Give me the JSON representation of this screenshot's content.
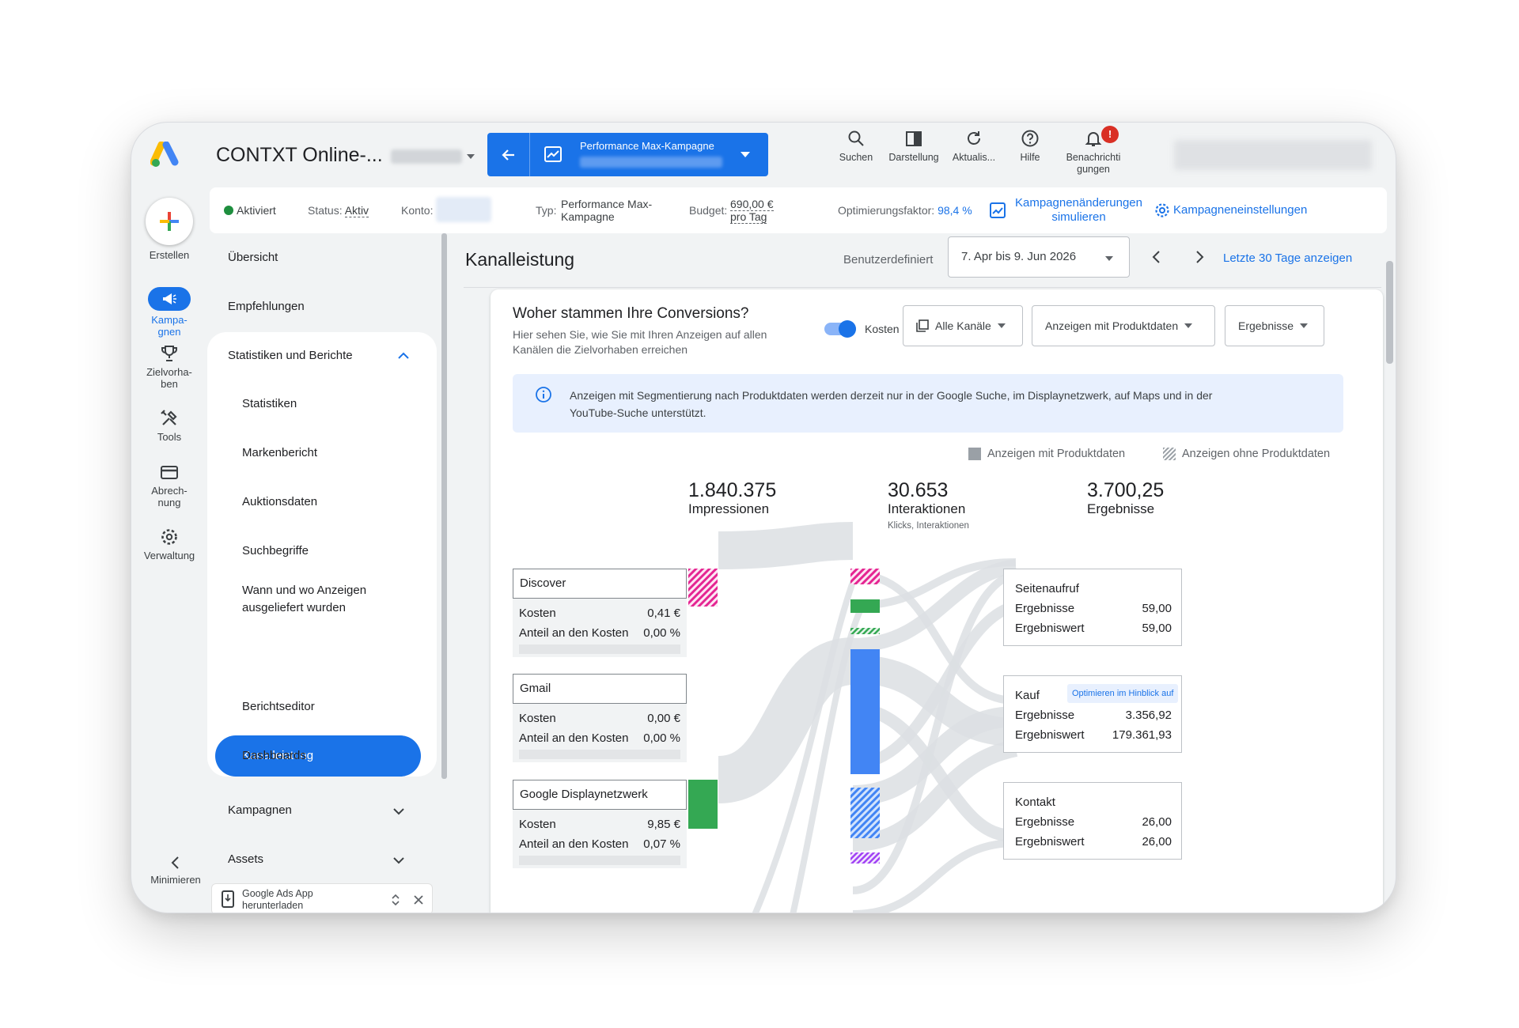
{
  "app": {
    "account_title": "CONTXT Online-...",
    "campaign_type": "Performance Max-Kampagne"
  },
  "toolbar": {
    "search": "Suchen",
    "appearance": "Darstellung",
    "refresh": "Aktualis...",
    "help": "Hilfe",
    "notifications_line1": "Benachrichti",
    "notifications_line2": "gungen",
    "notification_badge": "!"
  },
  "status": {
    "activated": "Aktiviert",
    "status_label": "Status:",
    "status_value": "Aktiv",
    "account_label": "Konto:",
    "type_label": "Typ:",
    "type_value_line1": "Performance Max-",
    "type_value_line2": "Kampagne",
    "budget_label": "Budget:",
    "budget_value_line1": "690,00 €",
    "budget_value_line2": "pro Tag",
    "opt_label": "Optimierungsfaktor:",
    "opt_value": "98,4 %",
    "simulate_line1": "Kampagnenänderungen",
    "simulate_line2": "simulieren",
    "settings": "Kampagneneinstellungen"
  },
  "rail": {
    "create": "Erstellen",
    "campaigns_line1": "Kampa-",
    "campaigns_line2": "gnen",
    "goals_line1": "Zielvorha-",
    "goals_line2": "ben",
    "tools": "Tools",
    "billing_line1": "Abrech-",
    "billing_line2": "nung",
    "admin": "Verwaltung",
    "minimize": "Minimieren"
  },
  "nav": {
    "overview": "Übersicht",
    "recommendations": "Empfehlungen",
    "insights_reports": "Statistiken und Berichte",
    "sub": {
      "statistics": "Statistiken",
      "brand_report": "Markenbericht",
      "auction": "Auktionsdaten",
      "search_terms": "Suchbegriffe",
      "where_when_line1": "Wann und wo Anzeigen",
      "where_when_line2": "ausgeliefert wurden",
      "channel_performance": "Kanalleistung",
      "report_editor": "Berichtseditor",
      "dashboards": "Dashboards"
    },
    "campaigns": "Kampagnen",
    "assets": "Assets",
    "app_download_line1": "Google Ads App",
    "app_download_line2": "herunterladen"
  },
  "main": {
    "title": "Kanalleistung",
    "date_label": "Benutzerdefiniert",
    "date_range": "7. Apr bis 9. Jun 2026",
    "last30": "Letzte 30 Tage anzeigen"
  },
  "card": {
    "title": "Woher stammen Ihre Conversions?",
    "subtitle_line1": "Hier sehen Sie, wie Sie mit Ihren Anzeigen auf allen",
    "subtitle_line2": "Kanälen die Zielvorhaben erreichen",
    "toggle_label": "Kosten",
    "dd_channels": "Alle Kanäle",
    "dd_product": "Anzeigen mit Produktdaten",
    "dd_results": "Ergebnisse",
    "info_line1": "Anzeigen mit Segmentierung nach Produktdaten werden derzeit nur in der Google Suche, im Displaynetzwerk, auf Maps und in der",
    "info_line2": "YouTube-Suche unterstützt.",
    "legend_with": "Anzeigen mit Produktdaten",
    "legend_without": "Anzeigen ohne Produktdaten"
  },
  "metrics": {
    "impressions_value": "1.840.375",
    "impressions_label": "Impressionen",
    "interactions_value": "30.653",
    "interactions_label": "Interaktionen",
    "interactions_sub": "Klicks, Interaktionen",
    "results_value": "3.700,25",
    "results_label": "Ergebnisse"
  },
  "sources": [
    {
      "name": "Discover",
      "cost_label": "Kosten",
      "cost": "0,41 €",
      "share_label": "Anteil an den Kosten",
      "share": "0,00 %"
    },
    {
      "name": "Gmail",
      "cost_label": "Kosten",
      "cost": "0,00 €",
      "share_label": "Anteil an den Kosten",
      "share": "0,00 %"
    },
    {
      "name": "Google Displaynetzwerk",
      "cost_label": "Kosten",
      "cost": "9,85 €",
      "share_label": "Anteil an den Kosten",
      "share": "0,07 %"
    }
  ],
  "results": [
    {
      "name": "Seitenaufruf",
      "r_label": "Ergebnisse",
      "r_value": "59,00",
      "v_label": "Ergebniswert",
      "v_value": "59,00",
      "chip": ""
    },
    {
      "name": "Kauf",
      "r_label": "Ergebnisse",
      "r_value": "3.356,92",
      "v_label": "Ergebniswert",
      "v_value": "179.361,93",
      "chip": "Optimieren im Hinblick auf"
    },
    {
      "name": "Kontakt",
      "r_label": "Ergebnisse",
      "r_value": "26,00",
      "v_label": "Ergebniswert",
      "v_value": "26,00",
      "chip": ""
    }
  ],
  "colors": {
    "brand_blue": "#1a73e8",
    "discover_pink": "#e52592",
    "display_green": "#34a853",
    "interaction_blue": "#4285f4",
    "conversion_teal": "#12b5cb",
    "purple": "#a142f4"
  }
}
